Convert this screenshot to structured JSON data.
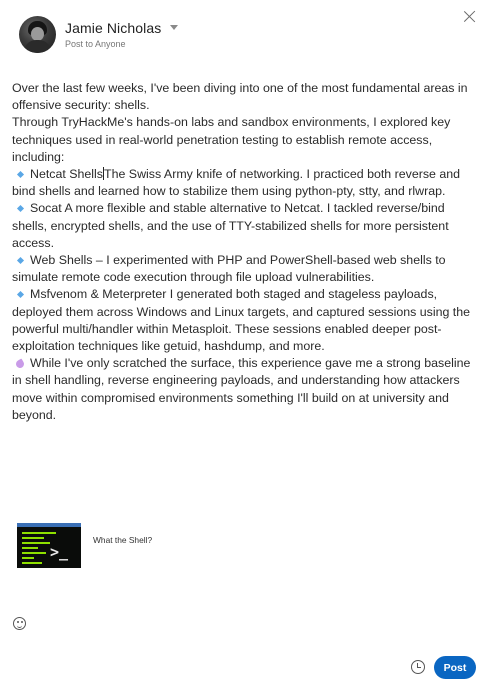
{
  "header": {
    "user_name": "Jamie Nicholas",
    "post_to": "Post to Anyone"
  },
  "icons": {
    "caret": "chevron-down-icon",
    "close": "close-icon",
    "bullet": "small-blue-diamond-icon",
    "sparkle": "sparkles-icon",
    "emoji": "smiley-icon",
    "schedule": "clock-icon"
  },
  "post": {
    "intro": "Over the last few weeks, I've been diving into one of the most fundamental areas in offensive security: shells.",
    "context": "Through TryHackMe's hands-on labs and sandbox environments, I explored key techniques used in real-world penetration testing to establish remote access, including:",
    "items": [
      {
        "title": "Netcat Shells",
        "body": "The Swiss Army knife of networking. I practiced both reverse and bind shells and learned how to stabilize them using python-pty, stty, and rlwrap."
      },
      {
        "title": "Socat",
        "body": "A more flexible and stable alternative to Netcat. I tackled reverse/bind shells, encrypted shells, and the use of TTY-stabilized shells for more persistent access."
      },
      {
        "title": "Web Shells",
        "body": "– I experimented with PHP and PowerShell-based web shells to simulate remote code execution through file upload vulnerabilities."
      },
      {
        "title": "Msfvenom & Meterpreter",
        "body": "I generated both staged and stageless payloads, deployed them across Windows and Linux targets, and captured sessions using the powerful multi/handler within Metasploit. These sessions enabled deeper post-exploitation techniques like getuid, hashdump, and more."
      }
    ],
    "closing": "While I've only scratched the surface, this experience gave me a strong baseline in shell handling, reverse engineering payloads, and understanding how attackers move within compromised environments something I'll build on at university and beyond."
  },
  "link_preview": {
    "title": "What the Shell?"
  },
  "footer": {
    "post_label": "Post"
  },
  "colors": {
    "accent": "#0a66c2",
    "bullet": "#5aa7e6",
    "terminal_green": "#8ee000"
  }
}
